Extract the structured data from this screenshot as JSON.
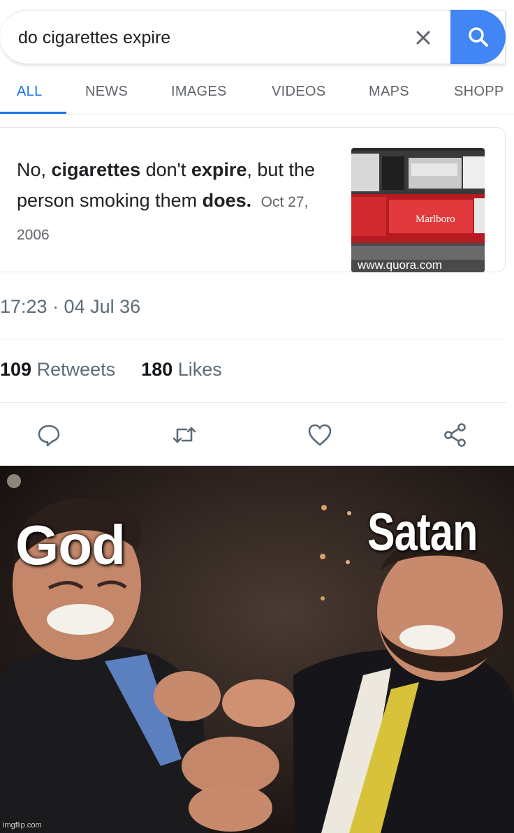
{
  "search": {
    "query": "do cigarettes expire",
    "clear_icon": "close-icon",
    "search_icon": "magnifier-icon"
  },
  "tabs": [
    {
      "label": "ALL",
      "active": true
    },
    {
      "label": "NEWS",
      "active": false
    },
    {
      "label": "IMAGES",
      "active": false
    },
    {
      "label": "VIDEOS",
      "active": false
    },
    {
      "label": "MAPS",
      "active": false
    },
    {
      "label": "SHOPP",
      "active": false
    }
  ],
  "answer": {
    "part1": "No, ",
    "bold1": "cigarettes",
    "part2": " don't ",
    "bold2": "expire",
    "part3": ", but the person smoking them ",
    "bold3": "does.",
    "date": "Oct 27, 2006",
    "thumb_source": "www.quora.com",
    "thumb_brand": "Marlboro"
  },
  "tweet": {
    "timestamp": "17:23 · 04 Jul 36",
    "retweets_count": "109",
    "retweets_label": "Retweets",
    "likes_count": "180",
    "likes_label": "Likes"
  },
  "actions": [
    "reply-icon",
    "retweet-icon",
    "like-icon",
    "share-icon"
  ],
  "meme": {
    "left_label": "God",
    "right_label": "Satan",
    "watermark": "imgflip.com"
  },
  "colors": {
    "google_blue": "#4285f4",
    "active_tab": "#1a73e8",
    "twitter_gray": "#5b6b78"
  }
}
